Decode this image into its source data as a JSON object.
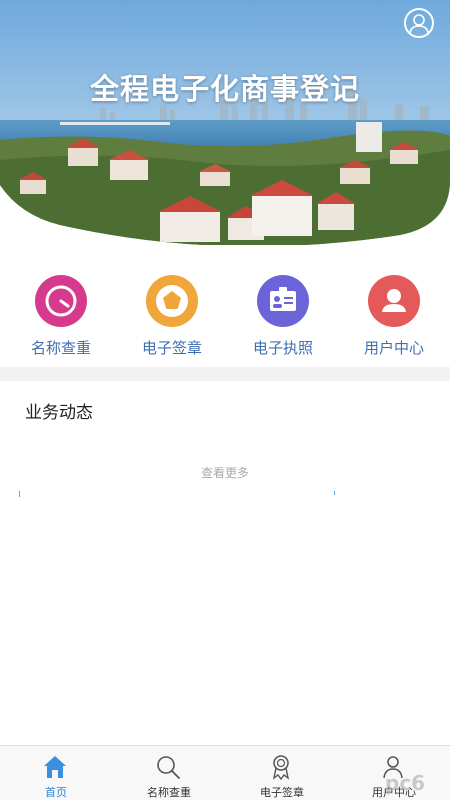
{
  "header": {
    "title": "全程电子化商事登记",
    "profile_icon": "user-outline-icon"
  },
  "quick_actions": [
    {
      "label": "名称查重",
      "icon": "gauge-icon",
      "color": "#d63a8c"
    },
    {
      "label": "电子签章",
      "icon": "pentagon-seal-icon",
      "color": "#f0a63a"
    },
    {
      "label": "电子执照",
      "icon": "id-card-icon",
      "color": "#6b63d8"
    },
    {
      "label": "用户中心",
      "icon": "person-icon",
      "color": "#e45a5a"
    }
  ],
  "news": {
    "title": "业务动态",
    "more_label": "查看更多"
  },
  "tabbar": {
    "items": [
      {
        "label": "首页",
        "icon": "home-icon",
        "active": true
      },
      {
        "label": "名称查重",
        "icon": "search-icon",
        "active": false
      },
      {
        "label": "电子签章",
        "icon": "seal-ribbon-icon",
        "active": false
      },
      {
        "label": "用户中心",
        "icon": "user-icon",
        "active": false
      }
    ]
  },
  "colors": {
    "accent": "#2f86d6",
    "label_blue": "#3f6fb0",
    "tab_text": "#333333"
  },
  "watermark": "pc6"
}
